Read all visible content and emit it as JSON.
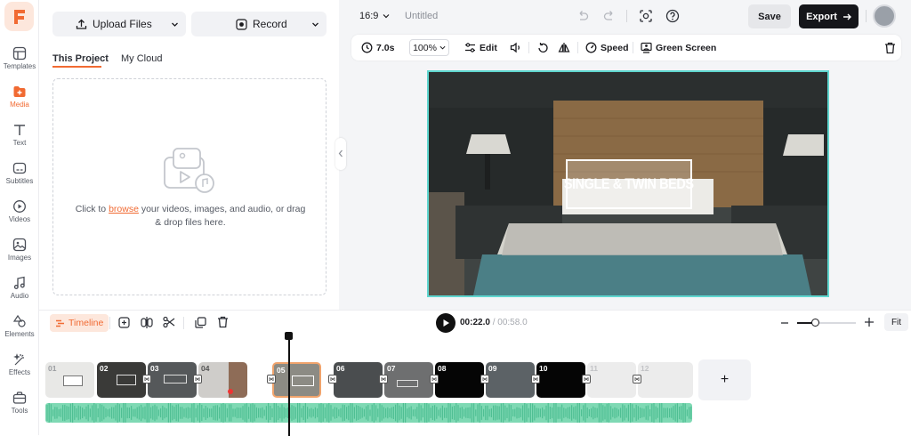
{
  "sidebar": {
    "items": [
      {
        "label": "Templates",
        "icon": "templates-icon"
      },
      {
        "label": "Media",
        "icon": "media-icon",
        "active": true
      },
      {
        "label": "Text",
        "icon": "text-icon"
      },
      {
        "label": "Subtitles",
        "icon": "subtitles-icon"
      },
      {
        "label": "Videos",
        "icon": "videos-icon"
      },
      {
        "label": "Images",
        "icon": "images-icon"
      },
      {
        "label": "Audio",
        "icon": "audio-icon"
      },
      {
        "label": "Elements",
        "icon": "elements-icon"
      },
      {
        "label": "Effects",
        "icon": "effects-icon"
      },
      {
        "label": "Tools",
        "icon": "tools-icon"
      }
    ]
  },
  "media_panel": {
    "upload_label": "Upload Files",
    "record_label": "Record",
    "tabs": [
      "This Project",
      "My Cloud"
    ],
    "drop_text_before": "Click to ",
    "drop_link": "browse",
    "drop_text_after": " your videos, images, and audio, or drag & drop files here."
  },
  "header": {
    "aspect_ratio": "16:9",
    "project_title": "Untitled",
    "save_label": "Save",
    "export_label": "Export"
  },
  "toolbar": {
    "duration": "7.0s",
    "zoom": "100%",
    "edit_label": "Edit",
    "speed_label": "Speed",
    "green_screen_label": "Green Screen"
  },
  "preview": {
    "overlay_text": "SINGLE & TWIN BEDS"
  },
  "timeline": {
    "label": "Timeline",
    "current_time": "00:22.0",
    "separator": "/",
    "total_time": "00:58.0",
    "fit_label": "Fit",
    "zoom_level": 0.3,
    "clips": [
      "01",
      "02",
      "03",
      "04",
      "05",
      "06",
      "07",
      "08",
      "09",
      "10",
      "11",
      "12"
    ],
    "selected_clip": "05",
    "add_label": "+"
  },
  "colors": {
    "accent": "#f16a32",
    "preview_border": "#5fd6cf",
    "audio_track": "#7fd9b4"
  }
}
